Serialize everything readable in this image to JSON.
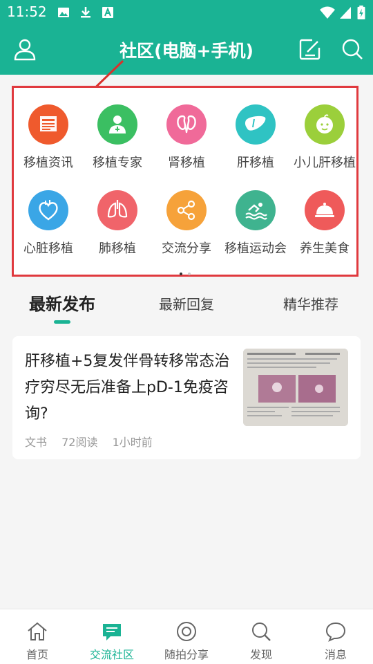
{
  "status_bar": {
    "time": "11:52",
    "icons": [
      "image-icon",
      "download-icon",
      "text-icon",
      "wifi-icon",
      "signal-icon",
      "battery-icon"
    ]
  },
  "header": {
    "title": "社区(电脑+手机)",
    "icons": [
      "user-icon",
      "edit-icon",
      "search-icon"
    ]
  },
  "categories": [
    {
      "label": "移植资讯",
      "color": "#ef5a2d",
      "icon": "news-icon"
    },
    {
      "label": "移植专家",
      "color": "#3bbf62",
      "icon": "doctor-icon"
    },
    {
      "label": "肾移植",
      "color": "#f06a99",
      "icon": "kidney-icon"
    },
    {
      "label": "肝移植",
      "color": "#2fc3c3",
      "icon": "liver-icon"
    },
    {
      "label": "小儿肝移植",
      "color": "#9bcf3b",
      "icon": "baby-icon"
    },
    {
      "label": "心脏移植",
      "color": "#3aa6e6",
      "icon": "heart-icon"
    },
    {
      "label": "肺移植",
      "color": "#f0646a",
      "icon": "lung-icon"
    },
    {
      "label": "交流分享",
      "color": "#f6a23a",
      "icon": "share-icon"
    },
    {
      "label": "移植运动会",
      "color": "#3fb38f",
      "icon": "swim-icon"
    },
    {
      "label": "养生美食",
      "color": "#ef5a5a",
      "icon": "food-icon"
    }
  ],
  "pager": {
    "pages": 2,
    "current": 1,
    "active_color": "#333333",
    "inactive_color": "#cccccc"
  },
  "tabs": [
    {
      "label": "最新发布",
      "active": true
    },
    {
      "label": "最新回复",
      "active": false
    },
    {
      "label": "精华推荐",
      "active": false
    }
  ],
  "post": {
    "title": "肝移植+5复发伴骨转移常态治疗穷尽无后准备上pD-1免疫咨询?",
    "author": "文书",
    "reads": "72阅读",
    "time": "1小时前"
  },
  "bottom_nav": [
    {
      "label": "首页",
      "icon": "home-icon",
      "active": false
    },
    {
      "label": "交流社区",
      "icon": "chat-icon",
      "active": true
    },
    {
      "label": "随拍分享",
      "icon": "camera-icon",
      "active": false
    },
    {
      "label": "发现",
      "icon": "discover-icon",
      "active": false
    },
    {
      "label": "消息",
      "icon": "message-icon",
      "active": false
    }
  ],
  "colors": {
    "brand": "#1ab394",
    "highlight_border": "#e0393e",
    "arrow": "#d9312b"
  }
}
